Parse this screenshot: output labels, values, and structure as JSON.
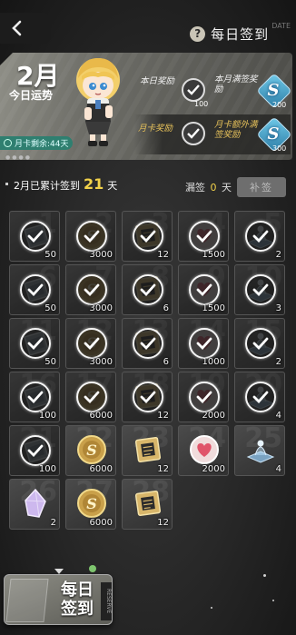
{
  "header": {
    "back_icon": "chevron-left-icon",
    "help_icon": "question-icon",
    "help_glyph": "?",
    "title": "每日签到",
    "watermark": "DATE"
  },
  "banner": {
    "month": "2月",
    "fortune_label": "今日运势",
    "month_card_remaining": "月卡剩余:44天",
    "rows": [
      {
        "label": "本日奖励",
        "slot_count": "100",
        "extra_label": "本月满签奖励",
        "extra_count": "200"
      },
      {
        "label": "月卡奖励",
        "slot_count": "",
        "extra_label": "月卡额外满签奖励",
        "extra_count": "300"
      }
    ]
  },
  "summary": {
    "prefix": "2月已累计签到",
    "days": "21",
    "suffix": "天",
    "missed_prefix": "漏签",
    "missed_days": "0",
    "missed_suffix": "天",
    "makeup_label": "补签"
  },
  "days": [
    {
      "day": "1",
      "type": "ticket",
      "qty": "50",
      "done": true
    },
    {
      "day": "2",
      "type": "coin",
      "qty": "3000",
      "done": true
    },
    {
      "day": "3",
      "type": "chip",
      "qty": "12",
      "done": true
    },
    {
      "day": "4",
      "type": "heart",
      "qty": "1500",
      "done": true
    },
    {
      "day": "5",
      "type": "hologram",
      "qty": "2",
      "done": true
    },
    {
      "day": "6",
      "type": "ticket",
      "qty": "50",
      "done": true
    },
    {
      "day": "7",
      "type": "coin",
      "qty": "3000",
      "done": true
    },
    {
      "day": "8",
      "type": "chip",
      "qty": "6",
      "done": true
    },
    {
      "day": "9",
      "type": "heart",
      "qty": "1500",
      "done": true
    },
    {
      "day": "10",
      "type": "hologram",
      "qty": "3",
      "done": true
    },
    {
      "day": "11",
      "type": "ticket",
      "qty": "50",
      "done": true
    },
    {
      "day": "12",
      "type": "coin",
      "qty": "3000",
      "done": true
    },
    {
      "day": "13",
      "type": "chip",
      "qty": "6",
      "done": true
    },
    {
      "day": "14",
      "type": "heart",
      "qty": "1000",
      "done": true
    },
    {
      "day": "15",
      "type": "hologram",
      "qty": "2",
      "done": true
    },
    {
      "day": "16",
      "type": "ticket",
      "qty": "100",
      "done": true
    },
    {
      "day": "17",
      "type": "coin",
      "qty": "6000",
      "done": true
    },
    {
      "day": "18",
      "type": "chip",
      "qty": "12",
      "done": true
    },
    {
      "day": "19",
      "type": "heart",
      "qty": "2000",
      "done": true
    },
    {
      "day": "20",
      "type": "hologram",
      "qty": "4",
      "done": true
    },
    {
      "day": "21",
      "type": "ticket",
      "qty": "100",
      "done": true
    },
    {
      "day": "22",
      "type": "coin",
      "qty": "6000",
      "done": false
    },
    {
      "day": "23",
      "type": "chip",
      "qty": "12",
      "done": false
    },
    {
      "day": "24",
      "type": "heart",
      "qty": "2000",
      "done": false
    },
    {
      "day": "25",
      "type": "hologram",
      "qty": "4",
      "done": false
    },
    {
      "day": "26",
      "type": "crystal",
      "qty": "2",
      "done": false
    },
    {
      "day": "27",
      "type": "coin",
      "qty": "6000",
      "done": false
    },
    {
      "day": "28",
      "type": "chip",
      "qty": "12",
      "done": false
    }
  ],
  "fab": {
    "label_line1": "每日",
    "label_line2": "签到",
    "ribbon": "RESERVE"
  },
  "colors": {
    "accent": "#f2d24a",
    "badge": "#2f7f70",
    "gold_label": "#e5c05a"
  }
}
